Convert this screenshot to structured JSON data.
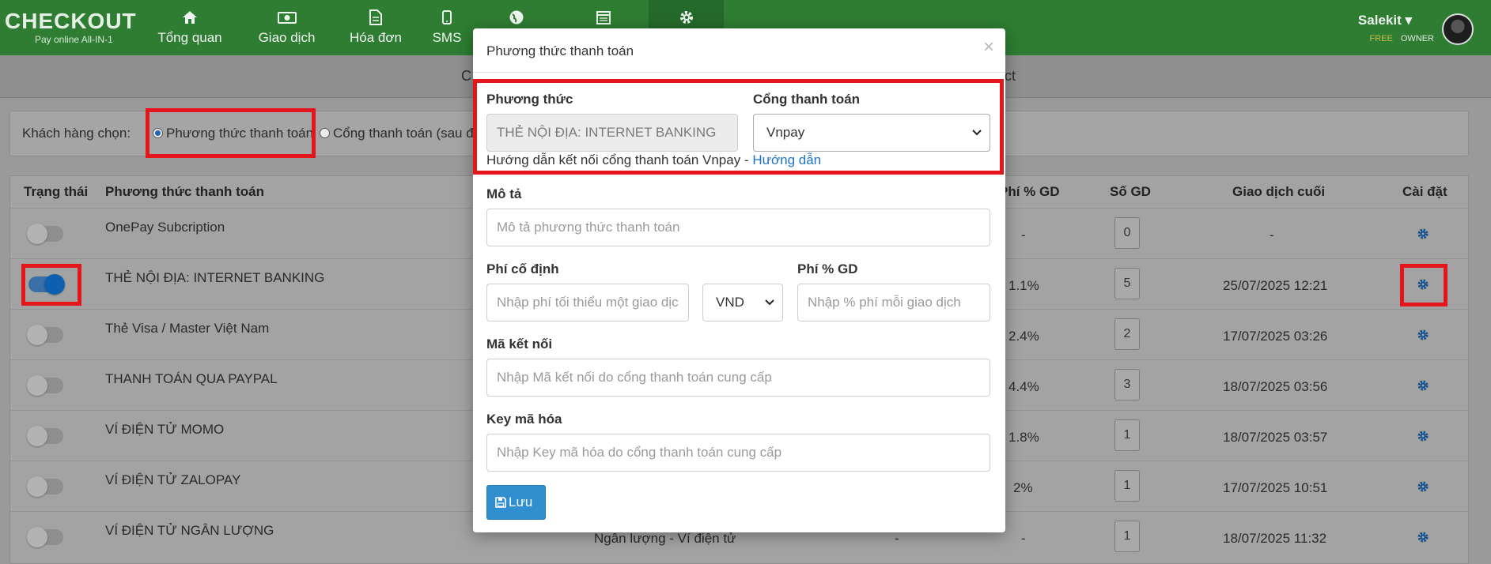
{
  "brand": {
    "logo": "CHECKOUT",
    "tagline": "Pay online All-IN-1"
  },
  "nav": [
    {
      "label": "Tổng quan",
      "icon": "home-icon"
    },
    {
      "label": "Giao dịch",
      "icon": "money-icon"
    },
    {
      "label": "Hóa đơn",
      "icon": "document-icon"
    },
    {
      "label": "SMS",
      "icon": "phone-icon"
    },
    {
      "label": "",
      "icon": "globe-icon"
    },
    {
      "label": "",
      "icon": "calendar-icon"
    },
    {
      "label": "",
      "icon": "gear-icon"
    }
  ],
  "user": {
    "name": "Salekit ▾",
    "plan": "FREE",
    "role": "OWNER"
  },
  "subbar": {
    "left_fragment": "C",
    "right_fragment": "ct"
  },
  "filter": {
    "label": "Khách hàng chọn:",
    "option_1": "Phương thức thanh toán",
    "option_2": "Cổng thanh toán (sau đó"
  },
  "table": {
    "headers": {
      "status": "Trạng thái",
      "method": "Phương thức thanh toán",
      "fee_pct": "Phí % GD",
      "count": "Số GD",
      "last": "Giao dịch cuối",
      "settings": "Cài đặt"
    },
    "rows": [
      {
        "enabled": false,
        "name": "OnePay Subcription",
        "gateway": "",
        "fixed": "",
        "pct": "-",
        "count": "0",
        "last": "-"
      },
      {
        "enabled": true,
        "name": "THẺ NỘI ĐỊA: INTERNET BANKING",
        "gateway": "",
        "fixed": "",
        "pct": "1.1%",
        "count": "5",
        "last": "25/07/2025 12:21"
      },
      {
        "enabled": false,
        "name": "Thẻ Visa / Master Việt Nam",
        "gateway": "",
        "fixed": "",
        "pct": "2.4%",
        "count": "2",
        "last": "17/07/2025 03:26"
      },
      {
        "enabled": false,
        "name": "THANH TOÁN QUA PAYPAL",
        "gateway": "",
        "fixed": "",
        "pct": "4.4%",
        "count": "3",
        "last": "18/07/2025 03:56"
      },
      {
        "enabled": false,
        "name": "VÍ ĐIỆN TỬ MOMO",
        "gateway": "",
        "fixed": "",
        "pct": "1.8%",
        "count": "1",
        "last": "18/07/2025 03:57"
      },
      {
        "enabled": false,
        "name": "VÍ ĐIỆN TỬ ZALOPAY",
        "gateway": "",
        "fixed": "",
        "pct": "2%",
        "count": "1",
        "last": "17/07/2025 10:51"
      },
      {
        "enabled": false,
        "name": "VÍ ĐIỆN TỬ NGÂN LƯỢNG",
        "gateway": "Ngân lượng - Ví điện tử",
        "fixed": "-",
        "pct": "-",
        "count": "1",
        "last": "18/07/2025 11:32"
      }
    ]
  },
  "modal": {
    "title": "Phương thức thanh toán",
    "close": "×",
    "method_label": "Phương thức",
    "method_value": "THẺ NỘI ĐỊA: INTERNET BANKING",
    "gateway_label": "Cổng thanh toán",
    "gateway_value": "Vnpay",
    "help_text": "Hướng dẫn kết nối cổng thanh toán Vnpay - ",
    "help_link": "Hướng dẫn",
    "desc_label": "Mô tả",
    "desc_placeholder": "Mô tả phương thức thanh toán",
    "fixed_label": "Phí cố định",
    "fixed_placeholder": "Nhập phí tối thiểu một giao dịch",
    "currency_value": "VND",
    "pct_label": "Phí % GD",
    "pct_placeholder": "Nhập % phí mỗi giao dịch",
    "conn_label": "Mã kết nối",
    "conn_placeholder": "Nhập Mã kết nối do cổng thanh toán cung cấp",
    "key_label": "Key mã hóa",
    "key_placeholder": "Nhập Key mã hóa do cổng thanh toán cung cấp",
    "save_label": "Lưu"
  },
  "colors": {
    "nav_bg": "#2e7d32",
    "highlight": "#e5161b",
    "primary": "#2f8fcf",
    "link": "#1a73c7"
  }
}
